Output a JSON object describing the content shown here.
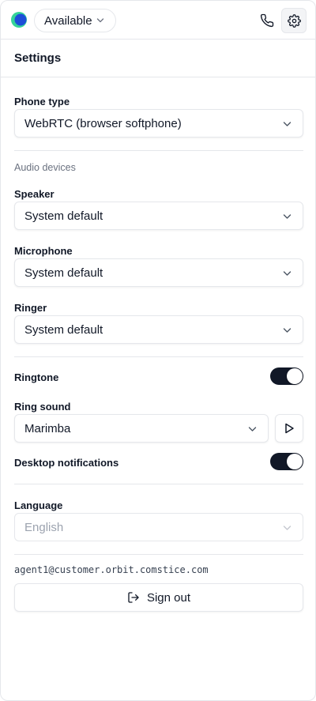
{
  "topbar": {
    "status_label": "Available"
  },
  "settings": {
    "title": "Settings",
    "phone_type": {
      "label": "Phone type",
      "value": "WebRTC (browser softphone)"
    },
    "audio_devices_heading": "Audio devices",
    "speaker": {
      "label": "Speaker",
      "value": "System default"
    },
    "microphone": {
      "label": "Microphone",
      "value": "System default"
    },
    "ringer": {
      "label": "Ringer",
      "value": "System default"
    },
    "ringtone": {
      "label": "Ringtone",
      "enabled": true
    },
    "ring_sound": {
      "label": "Ring sound",
      "value": "Marimba"
    },
    "desktop_notifications": {
      "label": "Desktop notifications",
      "enabled": true
    },
    "language": {
      "label": "Language",
      "value": "English",
      "disabled": true
    }
  },
  "account": {
    "email": "agent1@customer.orbit.comstice.com",
    "sign_out_label": "Sign out"
  },
  "colors": {
    "accent_dark": "#111827",
    "logo_teal": "#34d399",
    "logo_blue": "#1d4ed8",
    "border": "#e5e7eb",
    "muted": "#6b7280"
  }
}
